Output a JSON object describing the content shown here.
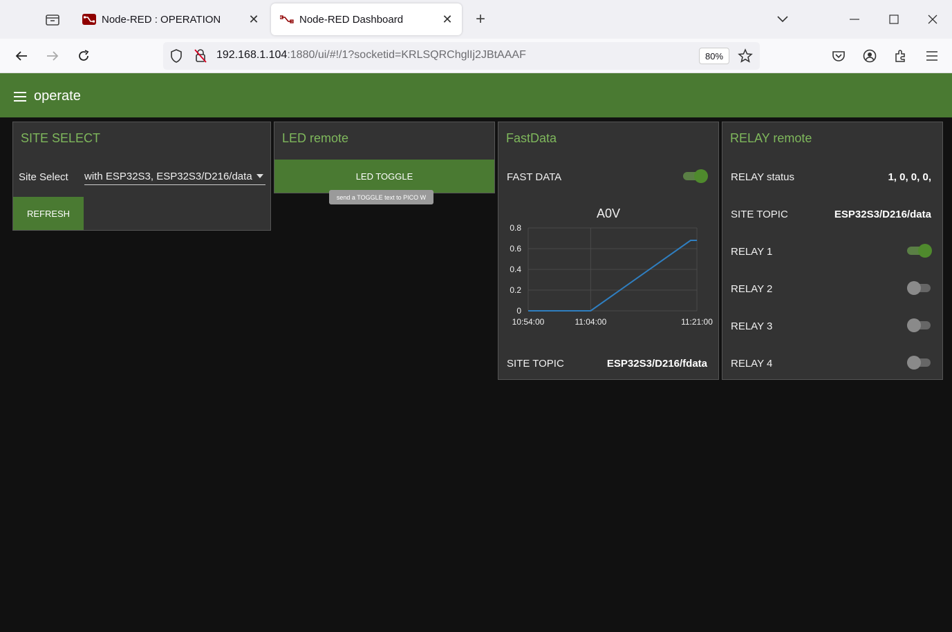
{
  "browser": {
    "tabs": [
      {
        "title": "Node-RED : OPERATION",
        "active": false
      },
      {
        "title": "Node-RED Dashboard",
        "active": true
      }
    ],
    "url_host": "192.168.1.104",
    "url_rest": ":1880/ui/#!/1?socketid=KRLSQRChglIj2JBtAAAF",
    "zoom": "80%"
  },
  "app": {
    "title": "operate",
    "accent_color": "#4a7a32"
  },
  "site_select": {
    "title": "SITE SELECT",
    "label": "Site Select",
    "selected": "with ESP32S3, ESP32S3/D216/data",
    "refresh_label": "REFRESH"
  },
  "led_remote": {
    "title": "LED remote",
    "button_label": "LED TOGGLE",
    "tooltip": "send a TOGGLE text to PICO W"
  },
  "fast_data": {
    "title": "FastData",
    "switch_label": "FAST DATA",
    "switch_on": true,
    "site_topic_label": "SITE TOPIC",
    "site_topic_value": "ESP32S3/D216/fdata"
  },
  "relay_remote": {
    "title": "RELAY remote",
    "status_label": "RELAY status",
    "status_value": "1, 0, 0, 0,",
    "site_topic_label": "SITE TOPIC",
    "site_topic_value": "ESP32S3/D216/data",
    "relays": [
      {
        "label": "RELAY 1",
        "on": true
      },
      {
        "label": "RELAY 2",
        "on": false
      },
      {
        "label": "RELAY 3",
        "on": false
      },
      {
        "label": "RELAY 4",
        "on": false
      }
    ]
  },
  "chart_data": {
    "type": "line",
    "title": "A0V",
    "x": [
      "10:54:00",
      "11:04:00",
      "11:20:00",
      "11:21:00"
    ],
    "x_tick_labels": [
      "10:54:00",
      "11:04:00",
      "11:21:00"
    ],
    "y_tick_labels": [
      "0",
      "0.2",
      "0.4",
      "0.6",
      "0.8"
    ],
    "series": [
      {
        "values": [
          0.0,
          0.0,
          0.68,
          0.68
        ],
        "color": "#2f7fc1"
      }
    ],
    "ylim": [
      0,
      0.8
    ],
    "grid": true
  }
}
